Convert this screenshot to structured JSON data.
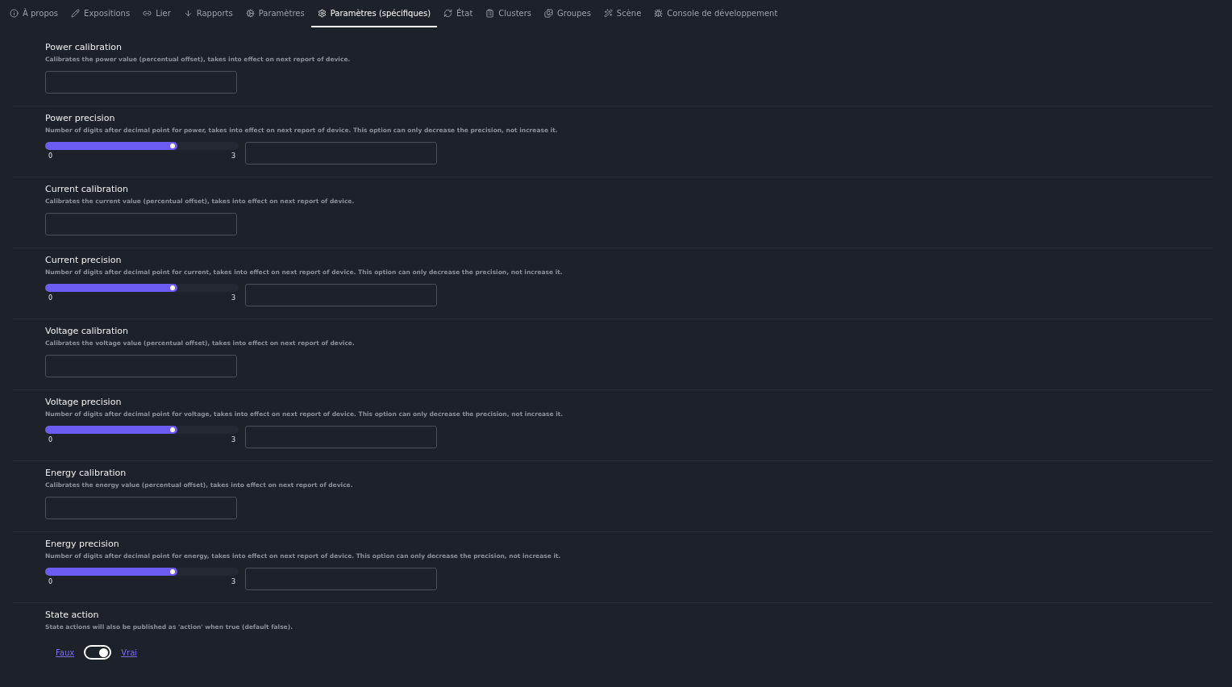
{
  "tabs": [
    {
      "label": "À propos",
      "selected": false
    },
    {
      "label": "Expositions",
      "selected": false
    },
    {
      "label": "Lier",
      "selected": false
    },
    {
      "label": "Rapports",
      "selected": false
    },
    {
      "label": "Paramètres",
      "selected": false
    },
    {
      "label": "Paramètres (spécifiques)",
      "selected": true
    },
    {
      "label": "État",
      "selected": false
    },
    {
      "label": "Clusters",
      "selected": false
    },
    {
      "label": "Groupes",
      "selected": false
    },
    {
      "label": "Scène",
      "selected": false
    },
    {
      "label": "Console de développement",
      "selected": false
    }
  ],
  "settings": [
    {
      "kind": "number",
      "title": "Power calibration",
      "description": "Calibrates the power value (percentual offset), takes into effect on next report of device."
    },
    {
      "kind": "slider",
      "title": "Power precision",
      "description": "Number of digits after decimal point for power, takes into effect on next report of device. This option can only decrease the precision, not increase it.",
      "level": 0.667,
      "min": "0",
      "max": "3"
    },
    {
      "kind": "number",
      "title": "Current calibration",
      "description": "Calibrates the current value (percentual offset), takes into effect on next report of device."
    },
    {
      "kind": "slider",
      "title": "Current precision",
      "description": "Number of digits after decimal point for current, takes into effect on next report of device. This option can only decrease the precision, not increase it.",
      "level": 0.667,
      "min": "0",
      "max": "3"
    },
    {
      "kind": "number",
      "title": "Voltage calibration",
      "description": "Calibrates the voltage value (percentual offset), takes into effect on next report of device."
    },
    {
      "kind": "slider",
      "title": "Voltage precision",
      "description": "Number of digits after decimal point for voltage, takes into effect on next report of device. This option can only decrease the precision, not increase it.",
      "level": 0.667,
      "min": "0",
      "max": "3"
    },
    {
      "kind": "number",
      "title": "Energy calibration",
      "description": "Calibrates the energy value (percentual offset), takes into effect on next report of device."
    },
    {
      "kind": "slider",
      "title": "Energy precision",
      "description": "Number of digits after decimal point for energy, takes into effect on next report of device. This option can only decrease the precision, not increase it.",
      "level": 0.667,
      "min": "0",
      "max": "3"
    },
    {
      "kind": "toggle",
      "title": "State action",
      "description": "State actions will also be published as 'action' when true (default false).",
      "off_label": "Faux",
      "on_label": "Vrai",
      "on": true
    }
  ]
}
